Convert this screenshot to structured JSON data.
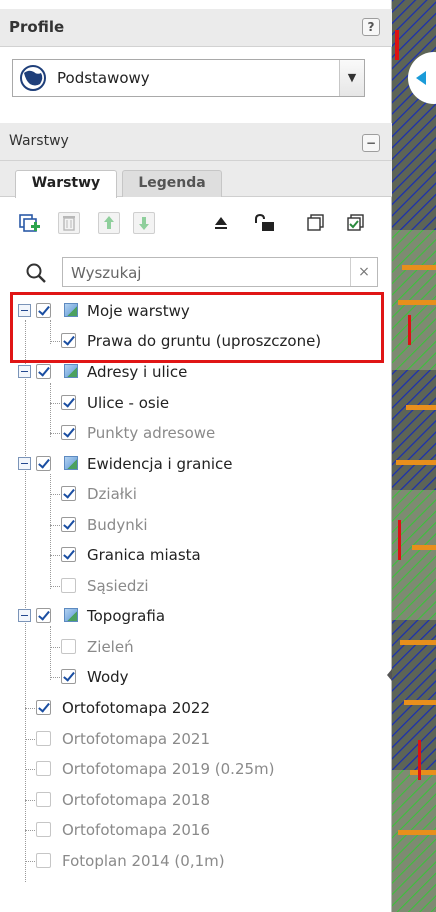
{
  "profile": {
    "title": "Profile",
    "help": "?",
    "selected": "Podstawowy"
  },
  "layers_panel": {
    "title": "Warstwy",
    "collapse": "−"
  },
  "tabs": [
    {
      "label": "Warstwy",
      "active": true
    },
    {
      "label": "Legenda",
      "active": false
    }
  ],
  "toolbar": {
    "buttons": [
      "add-layer-icon",
      "delete-icon",
      "move-up-icon",
      "move-down-icon",
      "eject-icon",
      "unlock-icon",
      "uncheck-all-icon",
      "check-all-icon"
    ]
  },
  "search": {
    "placeholder": "Wyszukaj",
    "clear": "×"
  },
  "tree": [
    {
      "label": "Moje warstwy",
      "group": true,
      "checked": true
    },
    {
      "label": "Prawa do gruntu (uproszczone)",
      "checked": true
    },
    {
      "label": "Adresy i ulice",
      "group": true,
      "checked": true
    },
    {
      "label": "Ulice - osie",
      "checked": true
    },
    {
      "label": "Punkty adresowe",
      "checked": true,
      "dim": true
    },
    {
      "label": "Ewidencja i granice",
      "group": true,
      "checked": true
    },
    {
      "label": "Działki",
      "checked": true,
      "dim": true
    },
    {
      "label": "Budynki",
      "checked": true,
      "dim": true
    },
    {
      "label": "Granica miasta",
      "checked": true
    },
    {
      "label": "Sąsiedzi",
      "checked": false,
      "dim": true
    },
    {
      "label": "Topografia",
      "group": true,
      "checked": true
    },
    {
      "label": "Zieleń",
      "checked": false,
      "dim": true
    },
    {
      "label": "Wody",
      "checked": true
    },
    {
      "label": "Ortofotomapa 2022",
      "checked": true
    },
    {
      "label": "Ortofotomapa 2021",
      "checked": false,
      "dim": true
    },
    {
      "label": "Ortofotomapa 2019 (0.25m)",
      "checked": false,
      "dim": true
    },
    {
      "label": "Ortofotomapa 2018",
      "checked": false,
      "dim": true
    },
    {
      "label": "Ortofotomapa 2016",
      "checked": false,
      "dim": true
    },
    {
      "label": "Fotoplan 2014 (0,1m)",
      "checked": false,
      "dim": true
    }
  ],
  "colors": {
    "highlight": "#e01515",
    "check": "#1a4ea2",
    "map_accent": "#1b9bd8"
  }
}
